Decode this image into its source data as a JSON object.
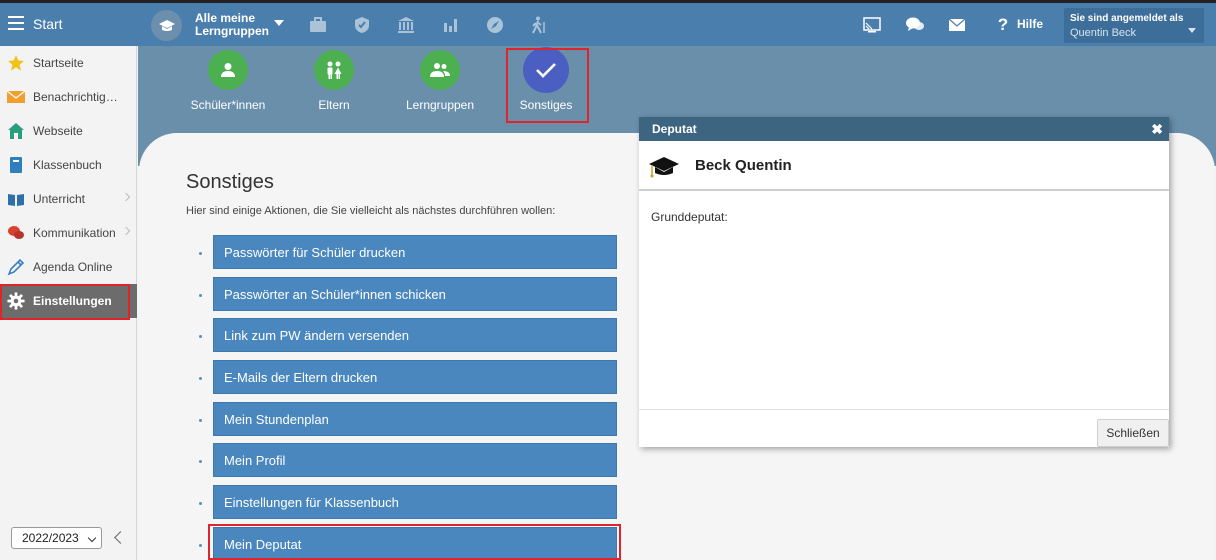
{
  "header": {
    "start_label": "Start",
    "group_label": "Alle meine Lerngruppen",
    "hilfe_label": "Hilfe",
    "user_caption": "Sie sind angemeldet als",
    "user_name": "Quentin Beck",
    "icons": [
      "briefcase-icon",
      "shield-icon",
      "bank-icon",
      "bar-chart-icon",
      "compass-icon",
      "hiking-icon",
      "cast-icon",
      "chat-icon",
      "mail-icon",
      "help-icon"
    ]
  },
  "sidebar": {
    "items": [
      {
        "label": "Startseite",
        "icon": "star-icon"
      },
      {
        "label": "Benachrichtigu…",
        "icon": "envelope-icon"
      },
      {
        "label": "Webseite",
        "icon": "house-icon"
      },
      {
        "label": "Klassenbuch",
        "icon": "book-icon"
      },
      {
        "label": "Unterricht",
        "icon": "open-book-icon"
      },
      {
        "label": "Kommunikation",
        "icon": "chat-bubbles-icon"
      },
      {
        "label": "Agenda Online",
        "icon": "pen-icon"
      },
      {
        "label": "Einstellungen",
        "icon": "gear-icon"
      }
    ],
    "year": "2022/2023"
  },
  "nav": {
    "tiles": [
      {
        "label": "Schüler*innen",
        "color": "#4caf50"
      },
      {
        "label": "Eltern",
        "color": "#4caf50"
      },
      {
        "label": "Lerngruppen",
        "color": "#4caf50"
      },
      {
        "label": "Sonstiges",
        "color": "#4a5fc1"
      }
    ]
  },
  "main": {
    "title": "Sonstiges",
    "subtitle": "Hier sind einige Aktionen, die Sie vielleicht als nächstes durchführen wollen:",
    "actions": [
      "Passwörter für Schüler drucken",
      "Passwörter an Schüler*innen schicken",
      "Link zum PW ändern versenden",
      "E-Mails der Eltern drucken",
      "Mein Stundenplan",
      "Mein Profil",
      "Einstellungen für Klassenbuch",
      "Mein Deputat"
    ]
  },
  "dialog": {
    "title": "Deputat",
    "close_symbol": "✖",
    "name": "Beck Quentin",
    "field_label": "Grunddeputat:",
    "close_button": "Schließen"
  },
  "colors": {
    "header": "#4a7fad",
    "band": "#6a8fab",
    "action": "#4a87bf",
    "highlight": "#e0242b"
  }
}
